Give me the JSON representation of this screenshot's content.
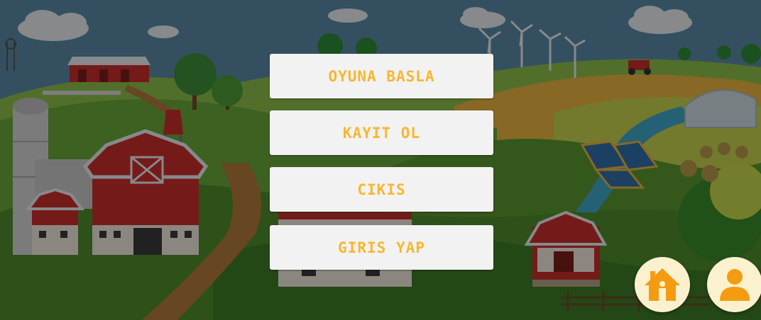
{
  "menu": {
    "items": [
      {
        "id": "start",
        "label": "OYUNA BASLA"
      },
      {
        "id": "register",
        "label": "KAYIT OL"
      },
      {
        "id": "exit",
        "label": "CIKIS"
      },
      {
        "id": "login",
        "label": "GIRIS YAP"
      }
    ],
    "label_color": "#f7b731",
    "button_bg": "#f2f2f2"
  },
  "corner_buttons": [
    {
      "id": "home",
      "icon": "home-icon",
      "color": "#f39c12"
    },
    {
      "id": "profile",
      "icon": "user-icon",
      "color": "#f39c12"
    }
  ],
  "background": {
    "theme": "farm-landscape",
    "sky_color": "#5b8aa6",
    "hill_colors": [
      "#7bb33c",
      "#5c9a2e",
      "#a8c34a",
      "#e0a93a"
    ],
    "barn_color": "#c9302c"
  }
}
